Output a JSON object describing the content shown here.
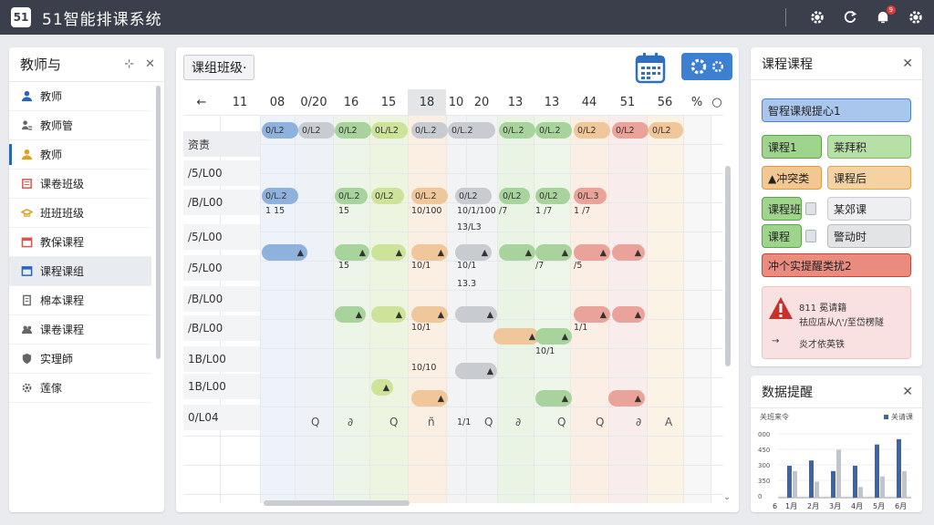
{
  "app": {
    "title": "51智能排课系统",
    "logo": "51",
    "notification_count": "9"
  },
  "left_panel": {
    "title": "教师与",
    "items": [
      {
        "label": "教师",
        "icon": "person-icon",
        "color": "#2b65b9"
      },
      {
        "label": "教师管",
        "icon": "person-list-icon",
        "color": "#666"
      },
      {
        "label": "教师",
        "icon": "person-icon",
        "color": "#e0a020"
      },
      {
        "label": "课卷班级",
        "icon": "book-icon",
        "color": "#d9534f"
      },
      {
        "label": "班班班级",
        "icon": "hat-icon",
        "color": "#e0a020"
      },
      {
        "label": "教保课程",
        "icon": "calendar-icon",
        "color": "#d9534f"
      },
      {
        "label": "课程课组",
        "icon": "window-icon",
        "color": "#2b65b9"
      },
      {
        "label": "棉本课程",
        "icon": "doc-icon",
        "color": "#666"
      },
      {
        "label": "课卷课程",
        "icon": "people-icon",
        "color": "#666"
      },
      {
        "label": "实理師",
        "icon": "shield-icon",
        "color": "#666"
      },
      {
        "label": "莲傢",
        "icon": "gear-icon",
        "color": "#666"
      }
    ]
  },
  "center": {
    "class_select": "课组班级·",
    "columns": [
      "←",
      "11",
      "08",
      "0/20",
      "16",
      "15",
      "18",
      "10",
      "20",
      "13",
      "13",
      "44",
      "51",
      "56",
      "%",
      "○"
    ],
    "rows": [
      "资责",
      "/5/L00",
      "/B/L00",
      "/5/L00",
      "/5/L00",
      "/B/L00",
      "/B/L00",
      "1B/L00",
      "1B/L00",
      "0/L04"
    ],
    "bottom_row": [
      "Q",
      "∂",
      "Q",
      "ñ",
      "Q",
      "∂",
      "Q",
      "Q",
      "∂",
      "A"
    ],
    "chip_texts": [
      "0/L2",
      "0/L2",
      "0/L2",
      "0L/L2",
      "0/L.2",
      "0/L.2",
      "0/L.2",
      "0/L.2",
      "0/L2",
      "0/L2",
      "0/L2",
      "0/L.2",
      "0/L.2",
      "0/L2",
      "0/L.2",
      "0/L2",
      "0/L2",
      "0/L2",
      "0/L.3"
    ],
    "cell_texts": [
      "1 15",
      "15",
      "10/100",
      "10/1/100",
      "13/L3",
      "/7",
      "1 /7",
      "1 /7",
      "15",
      "10/1",
      "10/1",
      "13.3",
      "/7",
      "/5",
      "1/1",
      "10/1",
      "10/1",
      "1/1",
      "10/10"
    ],
    "colors": {
      "blue": "#8fb2dd",
      "green": "#a9d39c",
      "orange": "#f0c79a",
      "gray": "#c8cbd0",
      "red": "#e9a39a",
      "yellowgreen": "#cde39a"
    }
  },
  "right_course": {
    "title": "课程课程",
    "buttons": [
      {
        "label": "智程课规提心1",
        "color": "#a9c6ec",
        "border": "#4a86d0"
      },
      {
        "label": "课程1",
        "color": "#9fd48d",
        "border": "#5aa44a"
      },
      {
        "label": "莱拜积",
        "color": "#b6e0a6",
        "border": "#7cba68"
      },
      {
        "label": "▲冲突类",
        "color": "#f2c792",
        "border": "#e0993e"
      },
      {
        "label": "课程后",
        "color": "#f4d2a2",
        "border": "#e0a24f"
      },
      {
        "label": "课程班",
        "color": "#9fd48d",
        "border": "#5aa44a"
      },
      {
        "label": "某郊课",
        "color": "#eeeff1",
        "border": "#c8cbd0"
      },
      {
        "label": "课程",
        "color": "#9fd48d",
        "border": "#5aa44a"
      },
      {
        "label": "警动时",
        "color": "#e3e4e6",
        "border": "#b8bbc0"
      },
      {
        "label": "冲个实提醒类扰2",
        "color": "#ea8b80",
        "border": "#c9463a"
      }
    ],
    "warning": {
      "line1": "811 冕请籍",
      "line2": "祛应店从/\\'/至岱楞隧",
      "line3": "炎才依英铁"
    }
  },
  "right_data": {
    "title": "数据提醒",
    "legend_left": "关班来令",
    "legend_right": "关请课",
    "chart_data": {
      "type": "bar",
      "categories": [
        "1月",
        "2月",
        "3月",
        "4月",
        "5月",
        "6月"
      ],
      "yticks": [
        "000",
        "450",
        "300",
        "350",
        "0"
      ],
      "series": [
        {
          "values": [
            300,
            350,
            250,
            300,
            500,
            550
          ]
        },
        {
          "values": [
            250,
            150,
            450,
            100,
            200,
            250
          ]
        }
      ],
      "xstart": "6"
    }
  }
}
